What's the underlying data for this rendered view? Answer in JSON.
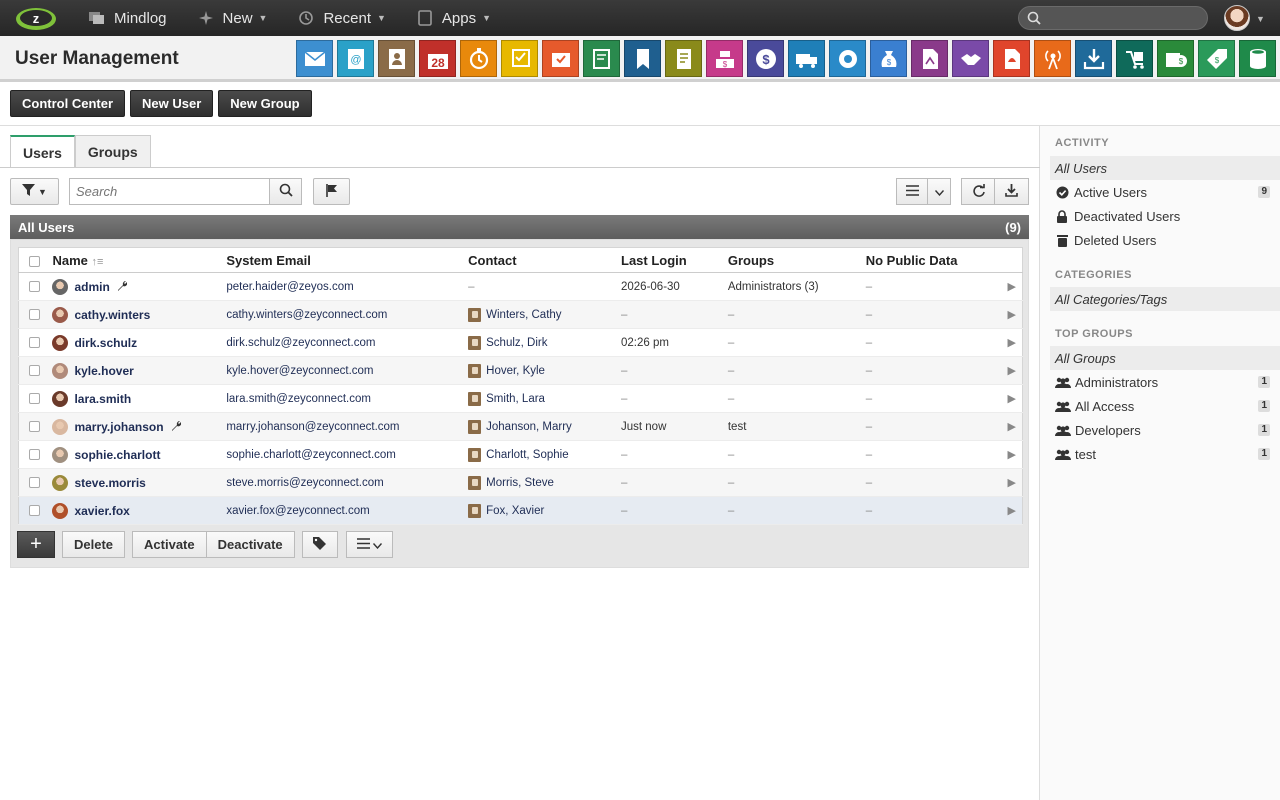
{
  "topbar": {
    "nav": [
      {
        "label": "Mindlog",
        "icon": "mindlog-icon"
      },
      {
        "label": "New",
        "icon": "sparkle-icon"
      },
      {
        "label": "Recent",
        "icon": "history-icon"
      },
      {
        "label": "Apps",
        "icon": "tablet-icon"
      }
    ],
    "search_placeholder": ""
  },
  "header": {
    "title": "User Management",
    "calendar_day": "28",
    "apps": [
      {
        "name": "mail",
        "color": "#3d8fd0"
      },
      {
        "name": "address-book",
        "color": "#2aa1c8"
      },
      {
        "name": "contacts",
        "color": "#8a6b48"
      },
      {
        "name": "calendar",
        "color": "#c0302a"
      },
      {
        "name": "timer",
        "color": "#e8890c"
      },
      {
        "name": "tasks",
        "color": "#e7b800"
      },
      {
        "name": "projects",
        "color": "#e65a2c"
      },
      {
        "name": "notes",
        "color": "#2a8a4e"
      },
      {
        "name": "bookmarks",
        "color": "#1f5f8f"
      },
      {
        "name": "documents",
        "color": "#8a8a1a"
      },
      {
        "name": "cashdesk",
        "color": "#c63a8a"
      },
      {
        "name": "finance",
        "color": "#4a4a9a"
      },
      {
        "name": "shipping",
        "color": "#1f7fb8"
      },
      {
        "name": "services",
        "color": "#2a8ac8"
      },
      {
        "name": "money-bag",
        "color": "#3a7fd0"
      },
      {
        "name": "legal",
        "color": "#8a3a8a"
      },
      {
        "name": "deals",
        "color": "#7a4aa8"
      },
      {
        "name": "pdf",
        "color": "#e0452c"
      },
      {
        "name": "broadcast",
        "color": "#e86a1a"
      },
      {
        "name": "downloads",
        "color": "#1f6a9a"
      },
      {
        "name": "storage",
        "color": "#0f6a5a"
      },
      {
        "name": "payments",
        "color": "#2a8a3a"
      },
      {
        "name": "pricing",
        "color": "#2a9a5a"
      },
      {
        "name": "database",
        "color": "#1f8a4a"
      }
    ]
  },
  "actions": {
    "control_center": "Control Center",
    "new_user": "New User",
    "new_group": "New Group"
  },
  "tabs": [
    "Users",
    "Groups"
  ],
  "search": {
    "placeholder": "Search"
  },
  "list": {
    "title": "All Users",
    "count": "(9)",
    "columns": [
      "Name",
      "System Email",
      "Contact",
      "Last Login",
      "Groups",
      "No Public Data"
    ],
    "rows": [
      {
        "name": "admin",
        "tool": true,
        "email": "peter.haider@zeyos.com",
        "contact": "–",
        "has_contact": false,
        "last_login": "2026-06-30",
        "groups": "Administrators (3)",
        "no_public": "–",
        "avatar": "#666"
      },
      {
        "name": "cathy.winters",
        "tool": false,
        "email": "cathy.winters@zeyconnect.com",
        "contact": "Winters, Cathy",
        "has_contact": true,
        "last_login": "–",
        "groups": "–",
        "no_public": "–",
        "avatar": "#9a5a4a"
      },
      {
        "name": "dirk.schulz",
        "tool": false,
        "email": "dirk.schulz@zeyconnect.com",
        "contact": "Schulz, Dirk",
        "has_contact": true,
        "last_login": "02:26 pm",
        "groups": "–",
        "no_public": "–",
        "avatar": "#7a3a2a"
      },
      {
        "name": "kyle.hover",
        "tool": false,
        "email": "kyle.hover@zeyconnect.com",
        "contact": "Hover, Kyle",
        "has_contact": true,
        "last_login": "–",
        "groups": "–",
        "no_public": "–",
        "avatar": "#b08a7a"
      },
      {
        "name": "lara.smith",
        "tool": false,
        "email": "lara.smith@zeyconnect.com",
        "contact": "Smith, Lara",
        "has_contact": true,
        "last_login": "–",
        "groups": "–",
        "no_public": "–",
        "avatar": "#6a3a2a"
      },
      {
        "name": "marry.johanson",
        "tool": true,
        "email": "marry.johanson@zeyconnect.com",
        "contact": "Johanson, Marry",
        "has_contact": true,
        "last_login": "Just now",
        "groups": "test",
        "no_public": "–",
        "avatar": "#d9b8a0"
      },
      {
        "name": "sophie.charlott",
        "tool": false,
        "email": "sophie.charlott@zeyconnect.com",
        "contact": "Charlott, Sophie",
        "has_contact": true,
        "last_login": "–",
        "groups": "–",
        "no_public": "–",
        "avatar": "#a09080"
      },
      {
        "name": "steve.morris",
        "tool": false,
        "email": "steve.morris@zeyconnect.com",
        "contact": "Morris, Steve",
        "has_contact": true,
        "last_login": "–",
        "groups": "–",
        "no_public": "–",
        "avatar": "#9a8a3a"
      },
      {
        "name": "xavier.fox",
        "tool": false,
        "email": "xavier.fox@zeyconnect.com",
        "contact": "Fox, Xavier",
        "has_contact": true,
        "last_login": "–",
        "groups": "–",
        "no_public": "–",
        "avatar": "#b0502a"
      }
    ]
  },
  "bottom": {
    "plus": "+",
    "delete": "Delete",
    "activate": "Activate",
    "deactivate": "Deactivate"
  },
  "sidebar": {
    "activity": {
      "heading": "ACTIVITY",
      "all": "All Users",
      "items": [
        {
          "label": "Active Users",
          "count": "9",
          "icon": "check-circle-icon"
        },
        {
          "label": "Deactivated Users",
          "count": "",
          "icon": "lock-icon"
        },
        {
          "label": "Deleted Users",
          "count": "",
          "icon": "trash-icon"
        }
      ]
    },
    "categories": {
      "heading": "CATEGORIES",
      "all": "All Categories/Tags"
    },
    "groups": {
      "heading": "TOP GROUPS",
      "all": "All Groups",
      "items": [
        {
          "label": "Administrators",
          "count": "1"
        },
        {
          "label": "All Access",
          "count": "1"
        },
        {
          "label": "Developers",
          "count": "1"
        },
        {
          "label": "test",
          "count": "1"
        }
      ]
    }
  }
}
